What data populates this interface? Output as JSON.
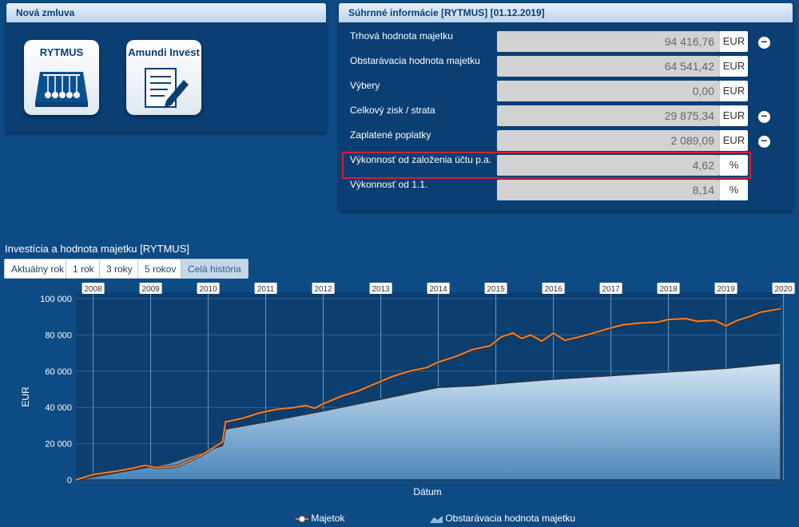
{
  "new_contract": {
    "title": "Nová zmluva",
    "tiles": [
      {
        "label": "RYTMUS",
        "icon": "newtons-cradle-icon"
      },
      {
        "label": "Amundi Invest",
        "icon": "contract-signing-icon"
      }
    ]
  },
  "summary": {
    "title": "Súhrnné informácie [RYTMUS] [01.12.2019]",
    "rows": [
      {
        "label": "Trhová hodnota majetku",
        "value": "94 416,76",
        "unit": "EUR"
      },
      {
        "label": "Obstarávacia hodnota majetku",
        "value": "64 541,42",
        "unit": "EUR"
      },
      {
        "label": "Výbery",
        "value": "0,00",
        "unit": "EUR"
      },
      {
        "label": "Celkový zisk / strata",
        "value": "29 875,34",
        "unit": "EUR"
      },
      {
        "label": "Zaplatené poplatky",
        "value": "2 089,09",
        "unit": "EUR"
      },
      {
        "label": "Výkonnosť od založenia účtu p.a.",
        "value": "4,62",
        "unit": "%"
      },
      {
        "label": "Výkonnosť od 1.1.",
        "value": "8,14",
        "unit": "%"
      }
    ],
    "minus_glyph": "−"
  },
  "chart_section": {
    "title": "Investícia a hodnota majetku [RYTMUS]",
    "buttons": [
      "Aktuálny rok",
      "1 rok",
      "3 roky",
      "5 rokov",
      "Celá história"
    ],
    "active_button": "Celá história"
  },
  "chart_data": {
    "type": "area",
    "xlabel": "Dátum",
    "ylabel": "EUR",
    "ylim": [
      0,
      100000
    ],
    "yticks": [
      0,
      20000,
      40000,
      60000,
      80000,
      100000
    ],
    "ytick_labels": [
      "0",
      "20 000",
      "40 000",
      "60 000",
      "80 000",
      "100 000"
    ],
    "year_labels": [
      "2008",
      "2009",
      "2010",
      "2011",
      "2012",
      "2013",
      "2014",
      "2015",
      "2016",
      "2017",
      "2018",
      "2019",
      "2020"
    ],
    "x_range": [
      2007.7,
      2019.95
    ],
    "grid": true,
    "legend_position": "bottom",
    "series": [
      {
        "name": "Majetok",
        "color": "#e8823a",
        "points": [
          [
            2007.7,
            0
          ],
          [
            2008.0,
            3000
          ],
          [
            2008.4,
            4800
          ],
          [
            2008.7,
            6500
          ],
          [
            2008.9,
            8000
          ],
          [
            2009.1,
            6800
          ],
          [
            2009.3,
            6900
          ],
          [
            2009.5,
            8000
          ],
          [
            2009.7,
            11000
          ],
          [
            2009.9,
            14000
          ],
          [
            2010.1,
            18000
          ],
          [
            2010.25,
            21000
          ],
          [
            2010.3,
            32000
          ],
          [
            2010.6,
            34000
          ],
          [
            2010.9,
            37000
          ],
          [
            2011.2,
            39000
          ],
          [
            2011.5,
            40000
          ],
          [
            2011.7,
            41000
          ],
          [
            2011.85,
            39500
          ],
          [
            2012.0,
            42000
          ],
          [
            2012.3,
            46000
          ],
          [
            2012.6,
            49000
          ],
          [
            2012.9,
            53000
          ],
          [
            2013.2,
            57000
          ],
          [
            2013.5,
            60000
          ],
          [
            2013.8,
            62000
          ],
          [
            2014.0,
            65000
          ],
          [
            2014.3,
            68000
          ],
          [
            2014.6,
            72000
          ],
          [
            2014.9,
            74000
          ],
          [
            2015.1,
            79000
          ],
          [
            2015.3,
            81000
          ],
          [
            2015.45,
            78000
          ],
          [
            2015.6,
            80000
          ],
          [
            2015.8,
            76500
          ],
          [
            2016.0,
            81000
          ],
          [
            2016.2,
            77000
          ],
          [
            2016.4,
            78500
          ],
          [
            2016.7,
            81000
          ],
          [
            2016.9,
            83000
          ],
          [
            2017.2,
            85500
          ],
          [
            2017.5,
            86500
          ],
          [
            2017.8,
            87000
          ],
          [
            2018.0,
            88500
          ],
          [
            2018.3,
            89000
          ],
          [
            2018.5,
            87500
          ],
          [
            2018.8,
            88000
          ],
          [
            2019.0,
            85000
          ],
          [
            2019.2,
            88000
          ],
          [
            2019.4,
            90000
          ],
          [
            2019.6,
            92500
          ],
          [
            2019.95,
            94400
          ]
        ]
      },
      {
        "name": "Obstarávacia hodnota majetku",
        "color": "#6ba3cf",
        "points": [
          [
            2007.7,
            0
          ],
          [
            2009.3,
            9000
          ],
          [
            2010.25,
            19000
          ],
          [
            2010.3,
            28000
          ],
          [
            2011.0,
            32000
          ],
          [
            2012.0,
            38000
          ],
          [
            2013.0,
            44500
          ],
          [
            2014.0,
            51000
          ],
          [
            2014.65,
            52000
          ],
          [
            2015.0,
            53000
          ],
          [
            2016.0,
            55500
          ],
          [
            2017.0,
            57500
          ],
          [
            2018.0,
            59500
          ],
          [
            2019.0,
            61500
          ],
          [
            2019.95,
            64500
          ]
        ]
      }
    ]
  }
}
